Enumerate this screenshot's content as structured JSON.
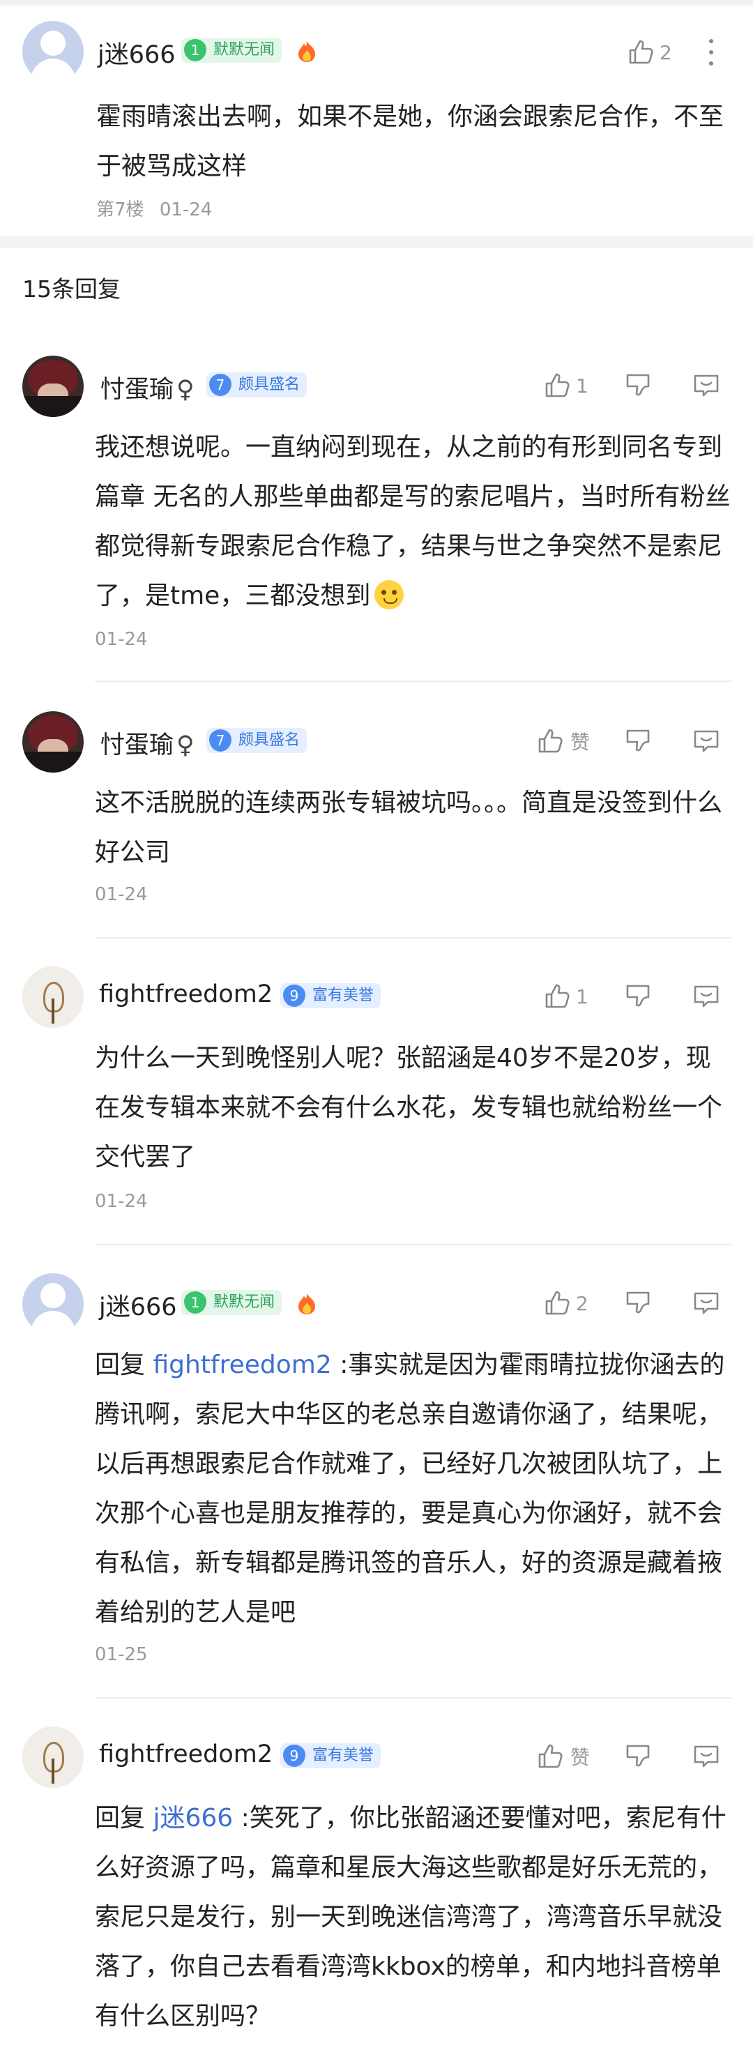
{
  "main_post": {
    "user": "j迷666",
    "level": "1",
    "badge": "默默无闻",
    "like_count": "2",
    "content": "霍雨晴滚出去啊，如果不是她，你涵会跟索尼合作，不至于被骂成这样",
    "floor": "第7楼",
    "date": "01-24"
  },
  "reply_count_label": "15条回复",
  "replies": [
    {
      "user": "忖蛋瑜",
      "gender": "♀",
      "level": "7",
      "badge": "颇具盛名",
      "like_label": "1",
      "content": "我还想说呢。一直纳闷到现在，从之前的有形到同名专到篇章 无名的人那些单曲都是写的索尼唱片，当时所有粉丝都觉得新专跟索尼合作稳了，结果与世之争突然不是索尼了，是tme，三都没想到",
      "emoji": "thinking-face-emoji",
      "date": "01-24"
    },
    {
      "user": "忖蛋瑜",
      "gender": "♀",
      "level": "7",
      "badge": "颇具盛名",
      "like_label": "赞",
      "content": "这不活脱脱的连续两张专辑被坑吗。。。简直是没签到什么好公司",
      "date": "01-24"
    },
    {
      "user": "fightfreedom2",
      "level": "9",
      "badge": "富有美誉",
      "like_label": "1",
      "content": "为什么一天到晚怪别人呢？张韶涵是40岁不是20岁，现在发专辑本来就不会有什么水花，发专辑也就给粉丝一个交代罢了",
      "date": "01-24"
    },
    {
      "user": "j迷666",
      "level": "1",
      "badge": "默默无闻",
      "like_label": "2",
      "reply_prefix": "回复 ",
      "reply_to": "fightfreedom2",
      "content": " :事实就是因为霍雨晴拉拢你涵去的腾讯啊，索尼大中华区的老总亲自邀请你涵了，结果呢，以后再想跟索尼合作就难了，已经好几次被团队坑了，上次那个心喜也是朋友推荐的，要是真心为你涵好，就不会有私信，新专辑都是腾讯签的音乐人，好的资源是藏着掖着给别的艺人是吧",
      "date": "01-25"
    },
    {
      "user": "fightfreedom2",
      "level": "9",
      "badge": "富有美誉",
      "like_label": "赞",
      "reply_prefix": "回复 ",
      "reply_to": "j迷666",
      "content": " :笑死了，你比张韶涵还要懂对吧，索尼有什么好资源了吗，篇章和星辰大海这些歌都是好乐无荒的，索尼只是发行，别一天到晚迷信湾湾了，湾湾音乐早就没落了，你自己去看看湾湾kkbox的榜单，和内地抖音榜单有什么区别吗？"
    }
  ]
}
